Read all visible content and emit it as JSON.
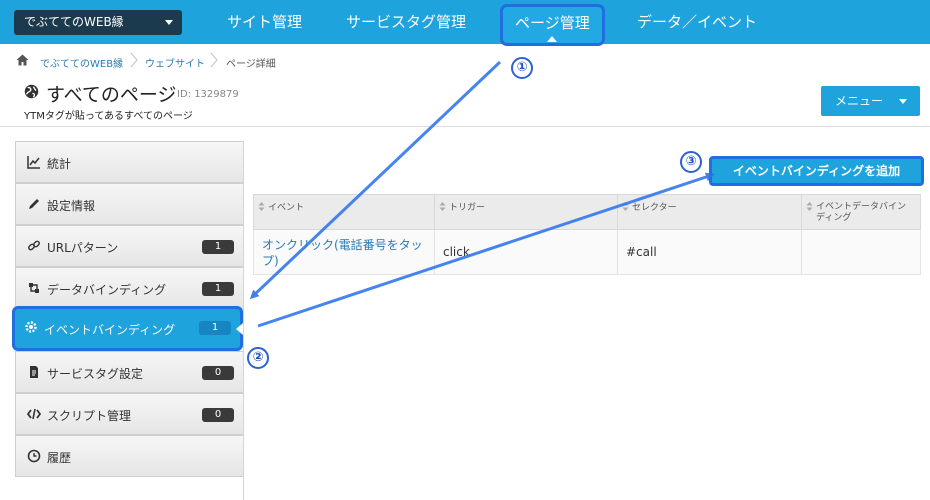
{
  "topbar": {
    "site_select": "でぶててのWEB縁",
    "nav": [
      "サイト管理",
      "サービスタグ管理",
      "ページ管理",
      "データ／イベント"
    ]
  },
  "breadcrumb": [
    "でぶててのWEB縁",
    "ウェブサイト",
    "ページ詳細"
  ],
  "page": {
    "title": "すべてのページ",
    "id_label": "ID: 1329879",
    "description": "YTMタグが貼ってあるすべてのページ",
    "menu_button": "メニュー"
  },
  "sidebar": {
    "items": [
      {
        "label": "統計",
        "icon": "chart-icon",
        "badge": ""
      },
      {
        "label": "設定情報",
        "icon": "pencil-icon",
        "badge": ""
      },
      {
        "label": "URLパターン",
        "icon": "link-icon",
        "badge": "1"
      },
      {
        "label": "データバインディング",
        "icon": "data-binding-icon",
        "badge": "1"
      },
      {
        "label": "イベントバインディング",
        "icon": "gear-icon",
        "badge": "1"
      },
      {
        "label": "サービスタグ設定",
        "icon": "document-icon",
        "badge": "0"
      },
      {
        "label": "スクリプト管理",
        "icon": "code-icon",
        "badge": "0"
      },
      {
        "label": "履歴",
        "icon": "clock-icon",
        "badge": ""
      }
    ],
    "active_index": 4
  },
  "main": {
    "add_button": "イベントバインディングを追加",
    "table": {
      "headers": [
        "イベント",
        "トリガー",
        "セレクター",
        "イベントデータバインディング"
      ],
      "rows": [
        [
          "オンクリック(電話番号をタップ)",
          "click",
          "#call",
          ""
        ]
      ]
    }
  },
  "callouts": [
    "①",
    "②",
    "③"
  ],
  "colors": {
    "brand": "#1ea3dc",
    "highlight": "#1f6fe0",
    "site_select": "#1c3a4d",
    "link": "#2a7ab5",
    "badge": "#3a3a3a"
  }
}
